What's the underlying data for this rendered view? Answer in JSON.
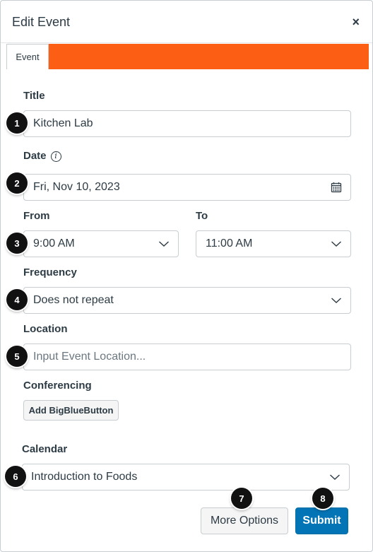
{
  "dialog": {
    "title": "Edit Event",
    "close_label": "×",
    "tab_label": "Event"
  },
  "form": {
    "title_label": "Title",
    "title_value": "Kitchen Lab",
    "date_label": "Date",
    "date_info_icon": "info-icon",
    "date_value": "Fri, Nov 10, 2023",
    "date_picker_icon": "calendar-icon",
    "from_label": "From",
    "from_value": "9:00 AM",
    "to_label": "To",
    "to_value": "11:00 AM",
    "frequency_label": "Frequency",
    "frequency_value": "Does not repeat",
    "location_label": "Location",
    "location_placeholder": "Input Event Location...",
    "conferencing_label": "Conferencing",
    "conferencing_button": "Add BigBlueButton",
    "calendar_label": "Calendar",
    "calendar_value": "Introduction to Foods"
  },
  "actions": {
    "more_options": "More Options",
    "submit": "Submit"
  },
  "callouts": [
    "1",
    "2",
    "3",
    "4",
    "5",
    "6",
    "7",
    "8"
  ],
  "colors": {
    "tab_accent": "#fc5e13",
    "submit_bg": "#0374b5",
    "border": "#c7cdd1",
    "text": "#2d3b45",
    "callout_bg": "#111111"
  }
}
